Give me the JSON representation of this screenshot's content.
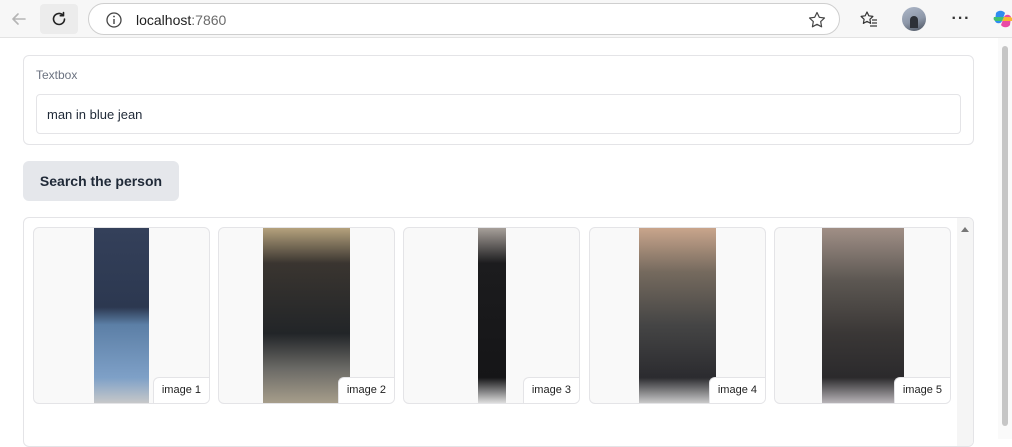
{
  "browser": {
    "address_host": "localhost",
    "address_port": ":7860",
    "icons": [
      "back-arrow-icon",
      "reload-icon",
      "info-icon",
      "star-icon",
      "favorites-icon",
      "profile-avatar",
      "more-icon",
      "copilot-icon"
    ]
  },
  "textbox": {
    "label": "Textbox",
    "value": "man in blue jean"
  },
  "search_button": {
    "label": "Search the person"
  },
  "gallery": {
    "items": [
      {
        "caption": "image 1"
      },
      {
        "caption": "image 2"
      },
      {
        "caption": "image 3"
      },
      {
        "caption": "image 4"
      },
      {
        "caption": "image 5"
      }
    ]
  },
  "colors": {
    "button_bg": "#e5e7eb",
    "border": "#e4e4e7",
    "label_text": "#6b7280"
  }
}
